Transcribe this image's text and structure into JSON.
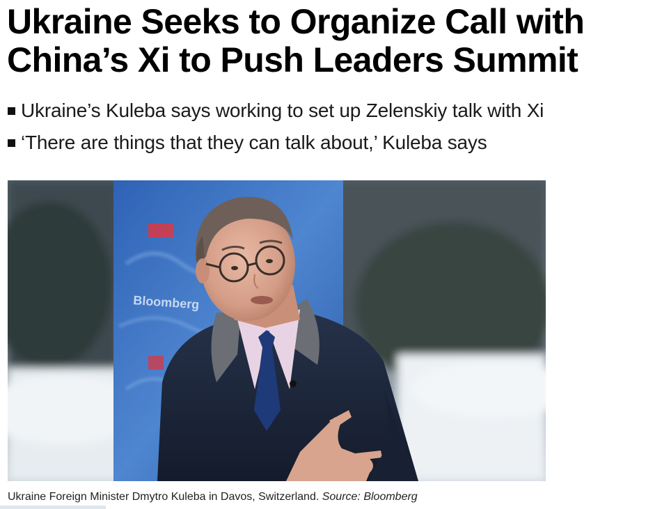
{
  "article": {
    "headline": "Ukraine Seeks to Organize Call with China’s Xi to Push Leaders Summit",
    "bullets": [
      "Ukraine’s Kuleba says working to set up Zelenskiy talk with Xi",
      "‘There are things that they can talk about,’ Kuleba says"
    ],
    "photo": {
      "backdrop_text": "Bloomberg"
    },
    "caption": {
      "text": "Ukraine Foreign Minister Dmytro Kuleba in Davos, Switzerland.",
      "source": "Source: Bloomberg"
    }
  }
}
